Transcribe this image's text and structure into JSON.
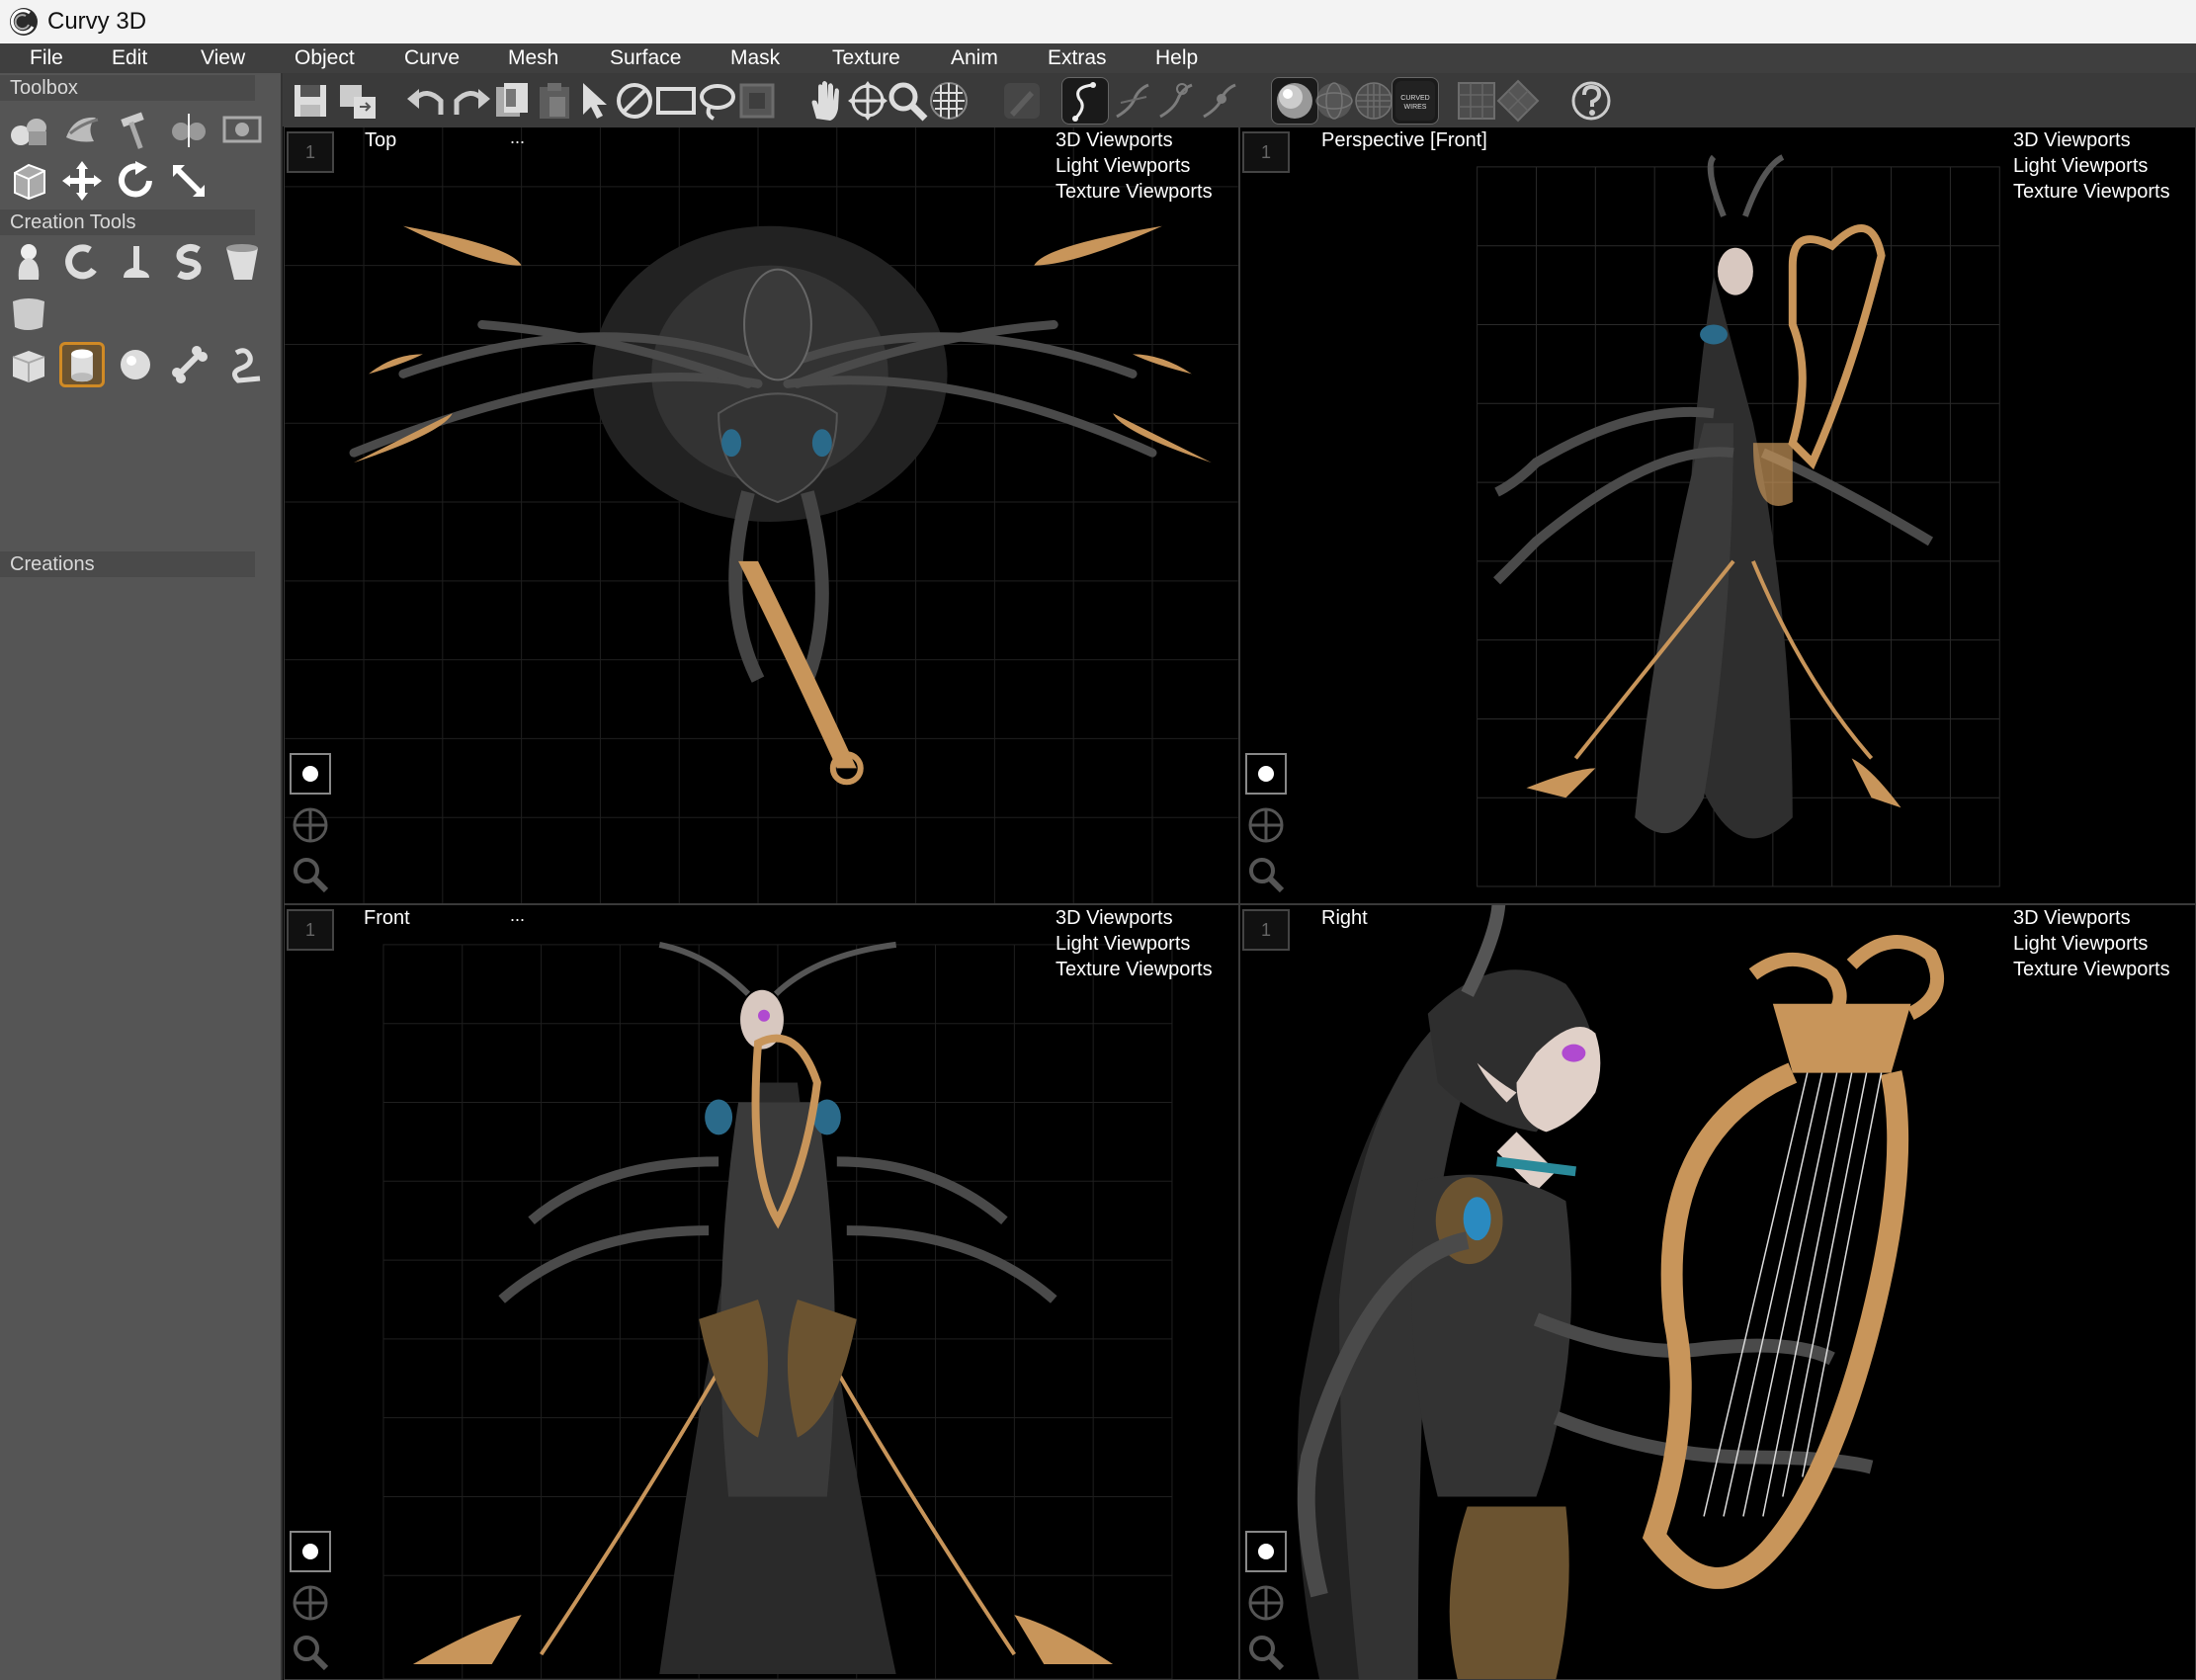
{
  "window": {
    "title": "Curvy 3D"
  },
  "menu": {
    "items": [
      "File",
      "Edit",
      "View",
      "Object",
      "Curve",
      "Mesh",
      "Surface",
      "Mask",
      "Texture",
      "Anim",
      "Extras",
      "Help"
    ]
  },
  "sidebar": {
    "toolbox_label": "Toolbox",
    "creation_tools_label": "Creation Tools",
    "creations_label": "Creations",
    "toolbox_icons": [
      "object-icon",
      "lathe-icon",
      "hammer-icon",
      "mirror-icon",
      "image-icon",
      "cube-frame-icon",
      "move-icon",
      "rotate-icon",
      "scale-icon"
    ],
    "creation_icons": [
      "blob-icon",
      "hook-icon",
      "boot-icon",
      "s-curve-icon",
      "cup-icon",
      "sheet-icon",
      "box-icon",
      "cylinder-icon",
      "sphere-icon",
      "bone-icon",
      "tube-icon"
    ]
  },
  "toolbar": {
    "icons": [
      "save-icon",
      "save-as-icon",
      "undo-icon",
      "redo-icon",
      "copy-icon",
      "paste-icon",
      "select-arrow-icon",
      "no-select-icon",
      "rectangle-select-icon",
      "lasso-select-icon",
      "mask-select-icon",
      "pan-hand-icon",
      "move-view-icon",
      "zoom-icon",
      "grid-toggle-icon",
      "pen-disabled-icon",
      "curve-draw-icon",
      "curve-edit-icon",
      "curve-point-icon",
      "curve-node-icon",
      "shaded-sphere-icon",
      "wire-sphere-icon",
      "mesh-sphere-icon",
      "curved-wires-icon",
      "grid-square-icon",
      "grid-diamond-icon",
      "help-icon"
    ],
    "curved_wires_label": "CURVED WIRES"
  },
  "viewports": [
    {
      "id": "top",
      "name": "Top",
      "dots": "...",
      "number": "1",
      "menu": [
        "3D Viewports",
        "Light Viewports",
        "Texture Viewports"
      ]
    },
    {
      "id": "perspective",
      "name": "Perspective [Front]",
      "dots": "",
      "number": "1",
      "menu": [
        "3D Viewports",
        "Light Viewports",
        "Texture Viewports"
      ]
    },
    {
      "id": "front",
      "name": "Front",
      "dots": "...",
      "number": "1",
      "menu": [
        "3D Viewports",
        "Light Viewports",
        "Texture Viewports"
      ]
    },
    {
      "id": "right",
      "name": "Right",
      "dots": "",
      "number": "1",
      "menu": [
        "3D Viewports",
        "Light Viewports",
        "Texture Viewports"
      ]
    }
  ],
  "colors": {
    "menubar": "#3f3f3f",
    "sidebar": "#555555",
    "toolbar": "#3a3a3a",
    "viewport": "#000000",
    "accent_orange": "#d08a25",
    "model_gold": "#c8955a",
    "model_dark": "#3a3a3a"
  }
}
